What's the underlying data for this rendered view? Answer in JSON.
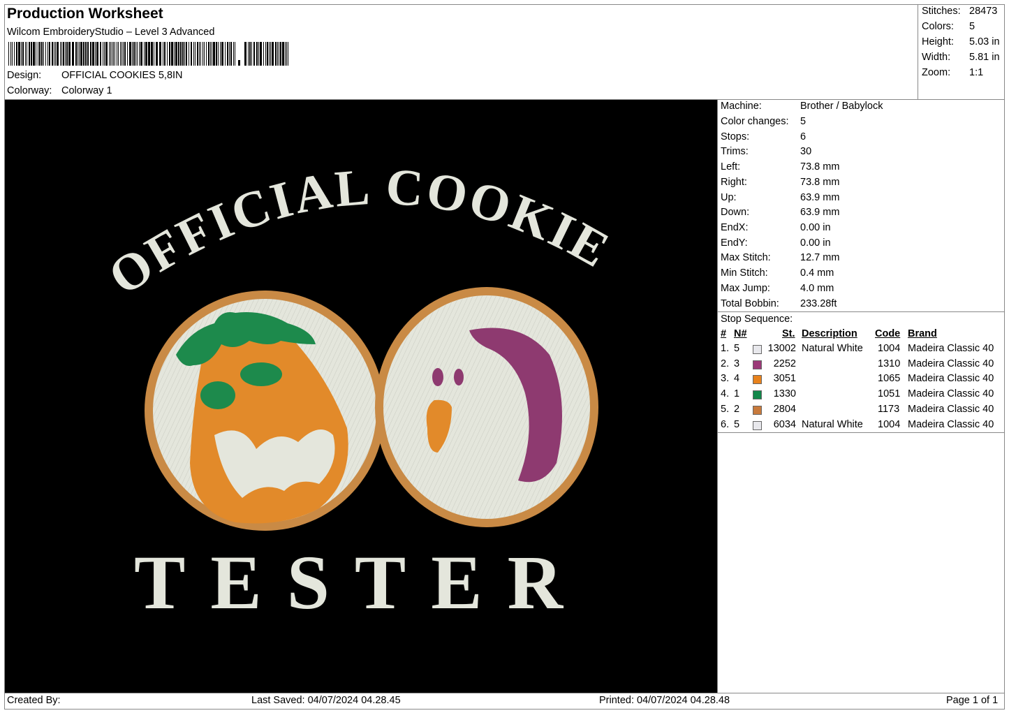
{
  "header": {
    "title": "Production Worksheet",
    "software": "Wilcom EmbroideryStudio – Level 3 Advanced",
    "design_label": "Design:",
    "design_value": "OFFICIAL COOKIES 5,8IN",
    "colorway_label": "Colorway:",
    "colorway_value": "Colorway 1"
  },
  "stats": [
    {
      "label": "Stitches:",
      "value": "28473"
    },
    {
      "label": "Colors:",
      "value": "5"
    },
    {
      "label": "Height:",
      "value": "5.03 in"
    },
    {
      "label": "Width:",
      "value": "5.81 in"
    },
    {
      "label": "Zoom:",
      "value": "1:1"
    }
  ],
  "specs": [
    {
      "label": "Machine:",
      "value": "Brother / Babylock"
    },
    {
      "label": "Color changes:",
      "value": "5"
    },
    {
      "label": "Stops:",
      "value": "6"
    },
    {
      "label": "Trims:",
      "value": "30"
    },
    {
      "label": "Left:",
      "value": "73.8 mm"
    },
    {
      "label": "Right:",
      "value": "73.8 mm"
    },
    {
      "label": "Up:",
      "value": "63.9 mm"
    },
    {
      "label": "Down:",
      "value": "63.9 mm"
    },
    {
      "label": "EndX:",
      "value": "0.00 in"
    },
    {
      "label": "EndY:",
      "value": "0.00 in"
    },
    {
      "label": "Max Stitch:",
      "value": "12.7 mm"
    },
    {
      "label": "Min Stitch:",
      "value": "0.4 mm"
    },
    {
      "label": "Max Jump:",
      "value": "4.0 mm"
    },
    {
      "label": "Total Bobbin:",
      "value": "233.28ft"
    }
  ],
  "stop_sequence": {
    "title": "Stop Sequence:",
    "columns": {
      "num": "#",
      "n": "N#",
      "st": "St.",
      "desc": "Description",
      "code": "Code",
      "brand": "Brand"
    },
    "rows": [
      {
        "num": "1.",
        "n": "5",
        "color": "#e8e8ec",
        "st": "13002",
        "desc": "Natural White",
        "code": "1004",
        "brand": "Madeira Classic 40"
      },
      {
        "num": "2.",
        "n": "3",
        "color": "#9b3a78",
        "st": "2252",
        "desc": "",
        "code": "1310",
        "brand": "Madeira Classic 40"
      },
      {
        "num": "3.",
        "n": "4",
        "color": "#e8821c",
        "st": "3051",
        "desc": "",
        "code": "1065",
        "brand": "Madeira Classic 40"
      },
      {
        "num": "4.",
        "n": "1",
        "color": "#12874a",
        "st": "1330",
        "desc": "",
        "code": "1051",
        "brand": "Madeira Classic 40"
      },
      {
        "num": "5.",
        "n": "2",
        "color": "#c87a3c",
        "st": "2804",
        "desc": "",
        "code": "1173",
        "brand": "Madeira Classic 40"
      },
      {
        "num": "6.",
        "n": "5",
        "color": "#e8e8ec",
        "st": "6034",
        "desc": "Natural White",
        "code": "1004",
        "brand": "Madeira Classic 40"
      }
    ]
  },
  "artwork": {
    "top_text": "OFFICIAL COOKIE",
    "bottom_text": "TESTER",
    "colors": {
      "white": "#e4e6dc",
      "purple": "#8e3a70",
      "orange": "#e28a2a",
      "green": "#1d8a4c",
      "tan": "#c98a45",
      "bg": "#000000"
    }
  },
  "footer": {
    "created_by": "Created By:",
    "last_saved": "Last Saved: 04/07/2024 04.28.45",
    "printed": "Printed: 04/07/2024 04.28.48",
    "page": "Page 1 of 1"
  }
}
